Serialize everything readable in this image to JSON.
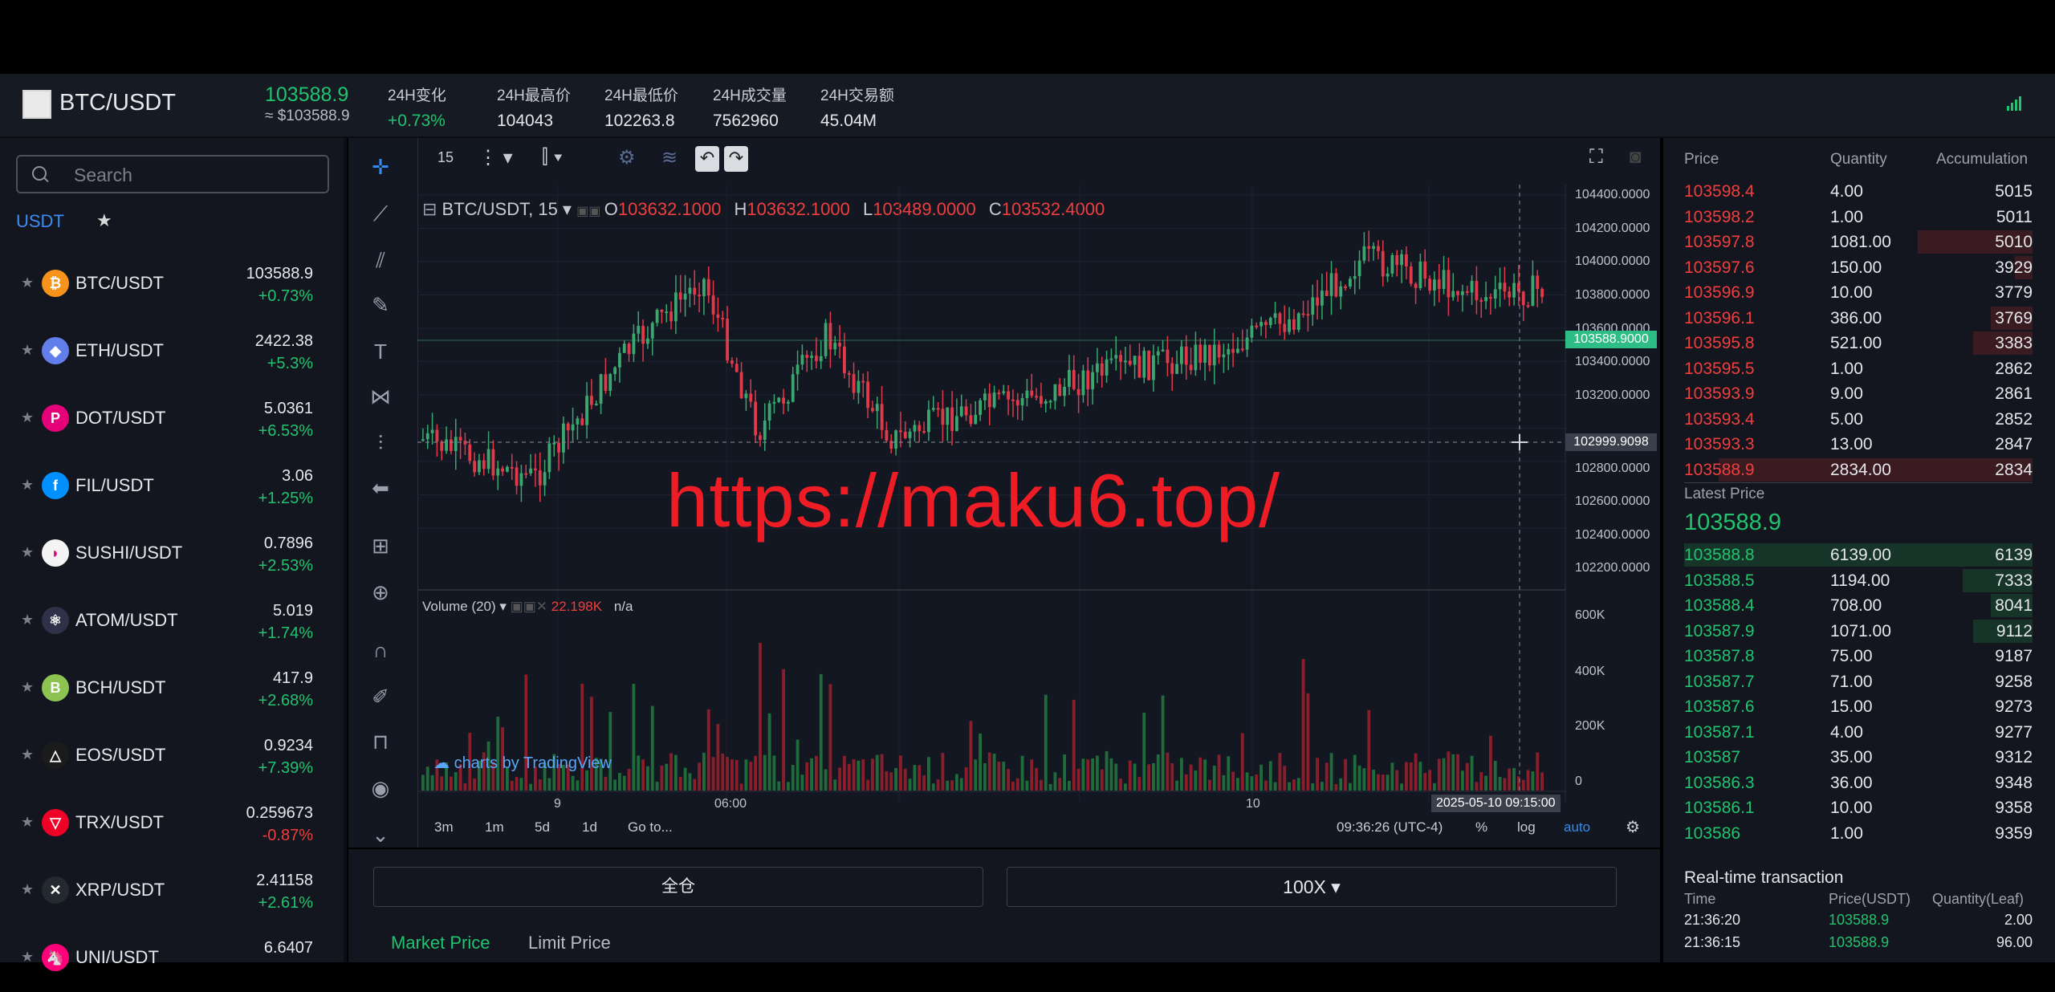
{
  "header": {
    "pair": "BTC/USDT",
    "last_price": "103588.9",
    "last_price_usd": "≈ $103588.9",
    "stats": [
      {
        "label": "24H变化",
        "value": "+0.73%"
      },
      {
        "label": "24H最高价",
        "value": "104043"
      },
      {
        "label": "24H最低价",
        "value": "102263.8"
      },
      {
        "label": "24H成交量",
        "value": "7562960"
      },
      {
        "label": "24H交易额",
        "value": "45.04M"
      }
    ]
  },
  "sidebar": {
    "search_placeholder": "Search",
    "tab_usdt": "USDT",
    "tab_fav": "★",
    "coins": [
      {
        "name": "BTC/USDT",
        "price": "103588.9",
        "change": "+0.73%",
        "color": "#f7931a",
        "glyph": "₿"
      },
      {
        "name": "ETH/USDT",
        "price": "2422.38",
        "change": "+5.3%",
        "color": "#627eea",
        "glyph": "◆"
      },
      {
        "name": "DOT/USDT",
        "price": "5.0361",
        "change": "+6.53%",
        "color": "#e6007a",
        "glyph": "P"
      },
      {
        "name": "FIL/USDT",
        "price": "3.06",
        "change": "+1.25%",
        "color": "#0090ff",
        "glyph": "f"
      },
      {
        "name": "SUSHI/USDT",
        "price": "0.7896",
        "change": "+2.53%",
        "color": "#f4f4f4",
        "glyph": "◗"
      },
      {
        "name": "ATOM/USDT",
        "price": "5.019",
        "change": "+1.74%",
        "color": "#2e3148",
        "glyph": "⚛"
      },
      {
        "name": "BCH/USDT",
        "price": "417.9",
        "change": "+2.68%",
        "color": "#8dc351",
        "glyph": "B"
      },
      {
        "name": "EOS/USDT",
        "price": "0.9234",
        "change": "+7.39%",
        "color": "#1b1b1b",
        "glyph": "△"
      },
      {
        "name": "TRX/USDT",
        "price": "0.259673",
        "change": "-0.87%",
        "color": "#ef0027",
        "glyph": "▽"
      },
      {
        "name": "XRP/USDT",
        "price": "2.41158",
        "change": "+2.61%",
        "color": "#23292f",
        "glyph": "✕"
      },
      {
        "name": "UNI/USDT",
        "price": "6.6407",
        "change": "",
        "color": "#ff007a",
        "glyph": "🦄"
      }
    ]
  },
  "chart": {
    "interval": "15",
    "symbol_legend": "BTC/USDT, 15",
    "ohlc": {
      "o_label": "O",
      "o": "103632.1000",
      "h_label": "H",
      "h": "103632.1000",
      "l_label": "L",
      "l": "103489.0000",
      "c_label": "C",
      "c": "103532.4000"
    },
    "volume_label": "Volume (20)",
    "volume_value": "22.198K",
    "volume_na": "n/a",
    "watermark": "https://maku6.top/",
    "price_axis": [
      "104400.0000",
      "104200.0000",
      "104000.0000",
      "103800.0000",
      "103600.0000",
      "103400.0000",
      "103200.0000",
      "102800.0000",
      "102600.0000",
      "102400.0000",
      "102200.0000"
    ],
    "current_price_tag": "103588.9000",
    "crosshair_price_tag": "102999.9098",
    "volume_axis": [
      "600K",
      "400K",
      "200K",
      "0"
    ],
    "time_axis": [
      "9",
      "06:00",
      "10"
    ],
    "crosshair_time": "2025-05-10 09:15:00",
    "brand": "charts by TradingView",
    "bottom_bar": {
      "r1": "3m",
      "r2": "1m",
      "r3": "5d",
      "r4": "1d",
      "goto": "Go to...",
      "clock": "09:36:26 (UTC-4)",
      "pct": "%",
      "log": "log",
      "auto": "auto"
    }
  },
  "order_form": {
    "margin_mode": "全仓",
    "leverage": "100X ▾",
    "tab_market": "Market Price",
    "tab_limit": "Limit Price"
  },
  "order_book": {
    "headers": {
      "price": "Price",
      "quantity": "Quantity",
      "accumulation": "Accumulation"
    },
    "asks": [
      {
        "p": "103598.4",
        "q": "4.00",
        "a": "5015",
        "d": 0.0
      },
      {
        "p": "103598.2",
        "q": "1.00",
        "a": "5011",
        "d": 0.0
      },
      {
        "p": "103597.8",
        "q": "1081.00",
        "a": "5010",
        "d": 0.33
      },
      {
        "p": "103597.6",
        "q": "150.00",
        "a": "3929",
        "d": 0.05
      },
      {
        "p": "103596.9",
        "q": "10.00",
        "a": "3779",
        "d": 0.0
      },
      {
        "p": "103596.1",
        "q": "386.00",
        "a": "3769",
        "d": 0.12
      },
      {
        "p": "103595.8",
        "q": "521.00",
        "a": "3383",
        "d": 0.17
      },
      {
        "p": "103595.5",
        "q": "1.00",
        "a": "2862",
        "d": 0.0
      },
      {
        "p": "103593.9",
        "q": "9.00",
        "a": "2861",
        "d": 0.0
      },
      {
        "p": "103593.4",
        "q": "5.00",
        "a": "2852",
        "d": 0.0
      },
      {
        "p": "103593.3",
        "q": "13.00",
        "a": "2847",
        "d": 0.0
      },
      {
        "p": "103588.9",
        "q": "2834.00",
        "a": "2834",
        "d": 0.9
      }
    ],
    "latest_label": "Latest Price",
    "latest_value": "103588.9",
    "bids": [
      {
        "p": "103588.8",
        "q": "6139.00",
        "a": "6139",
        "d": 1.0
      },
      {
        "p": "103588.5",
        "q": "1194.00",
        "a": "7333",
        "d": 0.2
      },
      {
        "p": "103588.4",
        "q": "708.00",
        "a": "8041",
        "d": 0.12
      },
      {
        "p": "103587.9",
        "q": "1071.00",
        "a": "9112",
        "d": 0.17
      },
      {
        "p": "103587.8",
        "q": "75.00",
        "a": "9187",
        "d": 0.0
      },
      {
        "p": "103587.7",
        "q": "71.00",
        "a": "9258",
        "d": 0.0
      },
      {
        "p": "103587.6",
        "q": "15.00",
        "a": "9273",
        "d": 0.0
      },
      {
        "p": "103587.1",
        "q": "4.00",
        "a": "9277",
        "d": 0.0
      },
      {
        "p": "103587",
        "q": "35.00",
        "a": "9312",
        "d": 0.0
      },
      {
        "p": "103586.3",
        "q": "36.00",
        "a": "9348",
        "d": 0.0
      },
      {
        "p": "103586.1",
        "q": "10.00",
        "a": "9358",
        "d": 0.0
      },
      {
        "p": "103586",
        "q": "1.00",
        "a": "9359",
        "d": 0.0
      }
    ]
  },
  "realtime": {
    "title": "Real-time transaction",
    "headers": {
      "time": "Time",
      "price": "Price(USDT)",
      "qty": "Quantity(Leaf)"
    },
    "rows": [
      {
        "t": "21:36:20",
        "p": "103588.9",
        "q": "2.00"
      },
      {
        "t": "21:36:15",
        "p": "103588.9",
        "q": "96.00"
      }
    ]
  }
}
